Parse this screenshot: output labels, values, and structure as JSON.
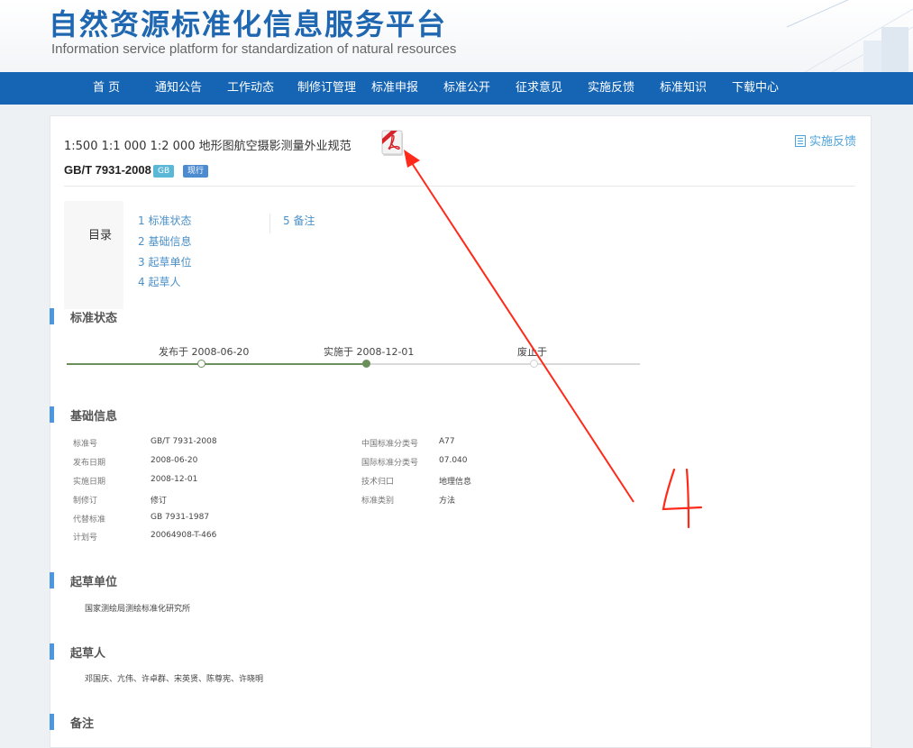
{
  "header": {
    "title": "自然资源标准化信息服务平台",
    "subtitle": "Information service platform for standardization of natural resources"
  },
  "nav": [
    {
      "label": "首 页"
    },
    {
      "label": "通知公告"
    },
    {
      "label": "工作动态"
    },
    {
      "label": "制修订管理"
    },
    {
      "label": "标准申报"
    },
    {
      "label": "标准公开"
    },
    {
      "label": "征求意见"
    },
    {
      "label": "实施反馈"
    },
    {
      "label": "标准知识"
    },
    {
      "label": "下载中心"
    }
  ],
  "standard": {
    "title": "1:500 1:1 000 1:2 000 地形图航空摄影测量外业规范",
    "code": "GB/T 7931-2008",
    "badge_type": "GB",
    "badge_status": "现行",
    "feedback_label": "实施反馈",
    "pdf_icon": "pdf-icon"
  },
  "toc": {
    "title": "目录",
    "items": [
      {
        "num": "1",
        "label": "标准状态"
      },
      {
        "num": "2",
        "label": "基础信息"
      },
      {
        "num": "3",
        "label": "起草单位"
      },
      {
        "num": "4",
        "label": "起草人"
      },
      {
        "num": "5",
        "label": "备注"
      }
    ]
  },
  "sections": {
    "status": "标准状态",
    "basic": "基础信息",
    "unit": "起草单位",
    "drafters": "起草人",
    "remarks": "备注"
  },
  "timeline": {
    "published": "发布于 2008-06-20",
    "implemented": "实施于 2008-12-01",
    "abolished": "废止于"
  },
  "basic_info": {
    "left": [
      {
        "label": "标准号",
        "value": "GB/T 7931-2008"
      },
      {
        "label": "发布日期",
        "value": "2008-06-20"
      },
      {
        "label": "实施日期",
        "value": "2008-12-01"
      },
      {
        "label": "制修订",
        "value": "修订"
      },
      {
        "label": "代替标准",
        "value": "GB 7931-1987"
      },
      {
        "label": "计划号",
        "value": "20064908-T-466"
      }
    ],
    "right": [
      {
        "label": "中国标准分类号",
        "value": "A77"
      },
      {
        "label": "国际标准分类号",
        "value": "07.040"
      },
      {
        "label": "技术归口",
        "value": "地理信息"
      },
      {
        "label": "标准类别",
        "value": "方法"
      }
    ]
  },
  "drafting_unit": "国家测绘局测绘标准化研究所",
  "drafters": "邓国庆、亢伟、许卓群、宋英贤、陈尊宪、许晓明",
  "annotation": {
    "handwritten_mark": "4",
    "color": "#ff2a1a"
  },
  "colors": {
    "nav_bg": "#1565b4",
    "brand": "#1f67b1",
    "section_bar": "#4c97e0",
    "link": "#4a90c8",
    "timeline_done": "#6b8f5a"
  }
}
